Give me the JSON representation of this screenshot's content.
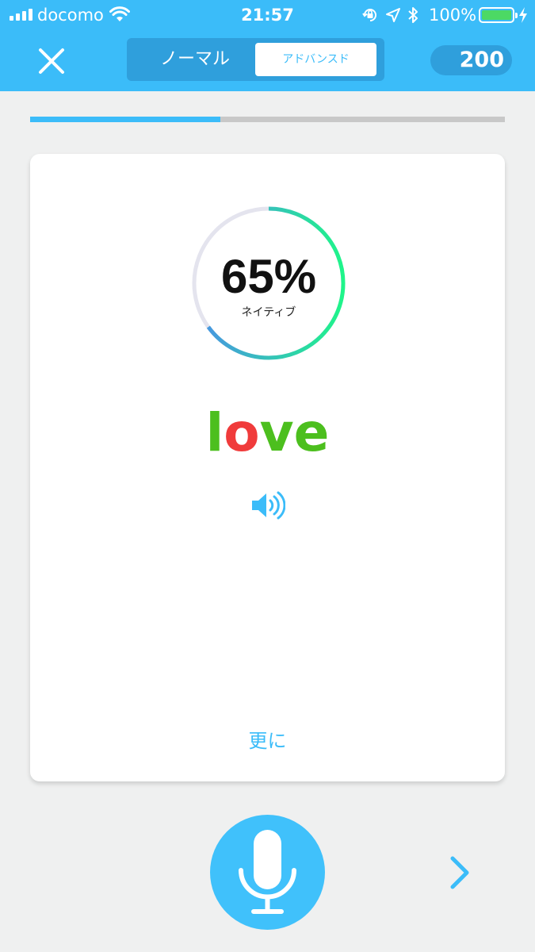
{
  "status_bar": {
    "carrier": "docomo",
    "time": "21:57",
    "battery_percent": "100%",
    "icons": [
      "signal-icon",
      "wifi-icon",
      "orientation-lock-icon",
      "location-icon",
      "bluetooth-icon",
      "battery-icon",
      "charging-icon"
    ]
  },
  "header": {
    "close_icon": "close-icon",
    "mode_tabs": [
      {
        "label": "ノーマル",
        "selected": false
      },
      {
        "label": "アドバンスド",
        "selected": true
      }
    ],
    "score": "200"
  },
  "progress": {
    "fraction": 0.4
  },
  "card": {
    "gauge": {
      "percent_label": "65%",
      "value": 65,
      "caption": "ネイティブ"
    },
    "word": {
      "letters": [
        {
          "char": "l",
          "color": "#4cbf1e"
        },
        {
          "char": "o",
          "color": "#f03b3b"
        },
        {
          "char": "v",
          "color": "#4cbf1e"
        },
        {
          "char": "e",
          "color": "#4cbf1e"
        }
      ]
    },
    "speaker_icon": "speaker-icon",
    "more_label": "更に"
  },
  "bottom": {
    "mic_icon": "microphone-icon",
    "next_icon": "chevron-right-icon"
  },
  "colors": {
    "accent": "#3bbcf9",
    "header_dark": "#2f9fdc",
    "background": "#eff0f0",
    "gauge_track": "#e4e4ee",
    "gauge_start": "#4b8fe8",
    "gauge_end": "#1ff58a"
  }
}
